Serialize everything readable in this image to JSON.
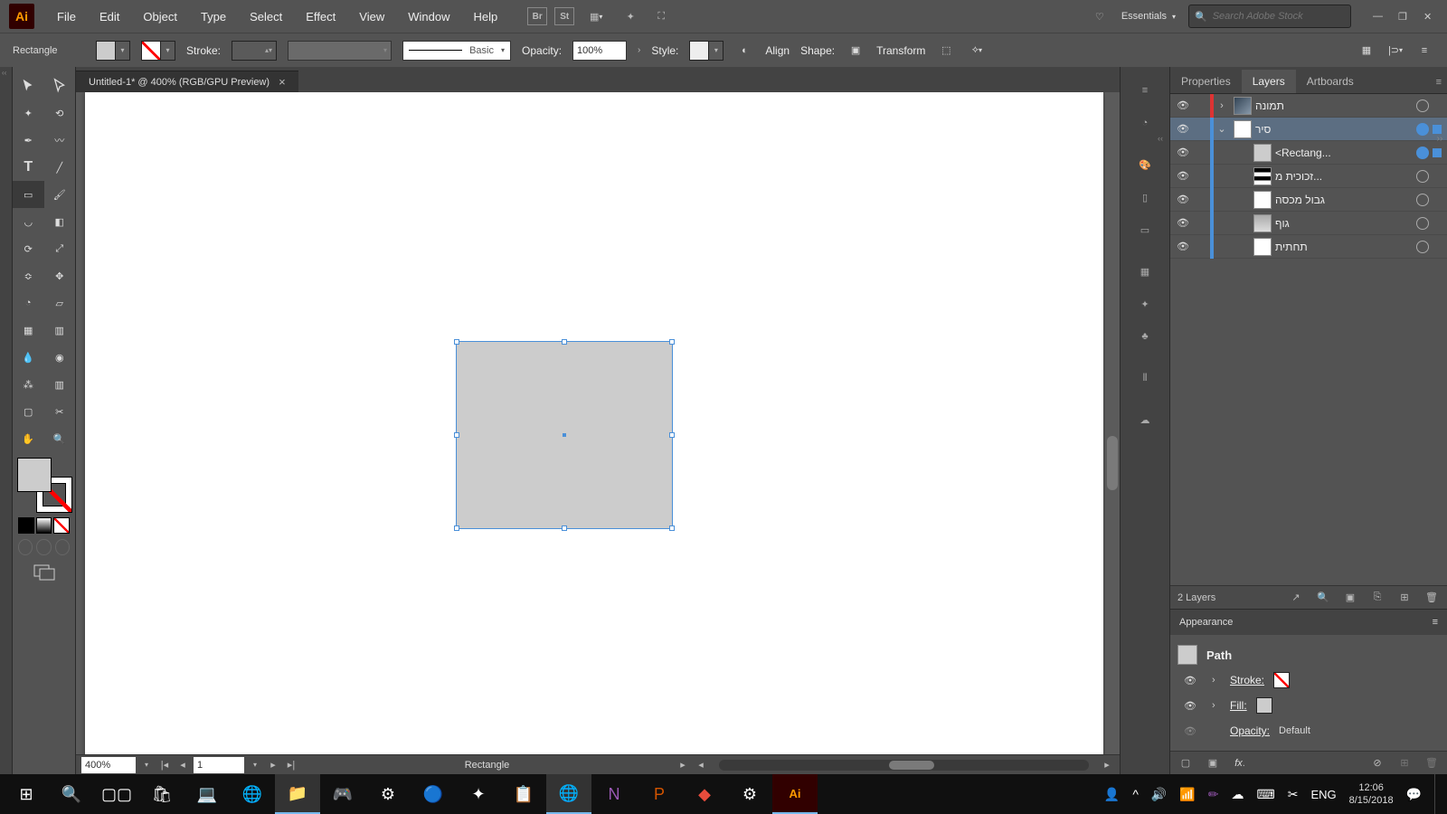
{
  "app": {
    "logo": "Ai"
  },
  "menu": [
    "File",
    "Edit",
    "Object",
    "Type",
    "Select",
    "Effect",
    "View",
    "Window",
    "Help"
  ],
  "menubar_boxes": [
    "Br",
    "St"
  ],
  "workspace": "Essentials",
  "search_placeholder": "Search Adobe Stock",
  "control": {
    "selection": "Rectangle",
    "stroke_label": "Stroke:",
    "brush_label": "Basic",
    "opacity_label": "Opacity:",
    "opacity_value": "100%",
    "style_label": "Style:",
    "align_label": "Align",
    "shape_label": "Shape:",
    "transform_label": "Transform"
  },
  "document": {
    "tab": "Untitled-1* @ 400% (RGB/GPU Preview)"
  },
  "panel_tabs": {
    "properties": "Properties",
    "layers": "Layers",
    "artboards": "Artboards"
  },
  "layers": [
    {
      "name": "תמונה",
      "color": "#d33",
      "thumb": "img",
      "exp": "›",
      "selected": false,
      "target": false,
      "selind": false
    },
    {
      "name": "סיר",
      "color": "#4a90d9",
      "thumb": "plain",
      "exp": "⌄",
      "selected": true,
      "target": true,
      "selind": true
    },
    {
      "name": "<Rectang...",
      "color": "#4a90d9",
      "thumb": "grey",
      "indent": 1,
      "selected": false,
      "target": true,
      "selind": true
    },
    {
      "name": "זכוכית מ...",
      "color": "#4a90d9",
      "thumb": "bars",
      "indent": 1
    },
    {
      "name": "גבול מכסה",
      "color": "#4a90d9",
      "thumb": "plain",
      "indent": 1
    },
    {
      "name": "גוף",
      "color": "#4a90d9",
      "thumb": "shape",
      "indent": 1
    },
    {
      "name": "תחתית",
      "color": "#4a90d9",
      "thumb": "plain",
      "indent": 1
    }
  ],
  "layers_footer": {
    "count": "2 Layers"
  },
  "appearance": {
    "title": "Appearance",
    "path": "Path",
    "stroke": "Stroke:",
    "fill": "Fill:",
    "opacity_label": "Opacity:",
    "opacity_value": "Default"
  },
  "status": {
    "zoom": "400%",
    "artboard": "1",
    "selection": "Rectangle"
  },
  "tray": {
    "lang": "ENG",
    "time": "12:06",
    "date": "8/15/2018"
  }
}
